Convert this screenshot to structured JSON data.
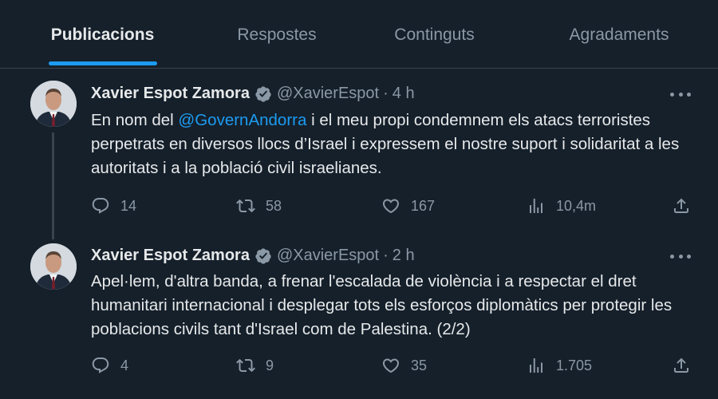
{
  "tabs": [
    {
      "label": "Publicacions",
      "active": true
    },
    {
      "label": "Respostes"
    },
    {
      "label": "Continguts"
    },
    {
      "label": "Agradaments"
    }
  ],
  "tweets": [
    {
      "name": "Xavier Espot Zamora",
      "handle": "@XavierEspot",
      "time": "4 h",
      "text_before": "En nom del ",
      "mention": "@GovernAndorra",
      "text_after": " i el meu propi condemnem els atacs terroristes perpetrats en diversos llocs d’Israel i expressem el nostre suport i solidaritat a les autoritats i a la població civil israelianes.",
      "replies": "14",
      "retweets": "58",
      "likes": "167",
      "views": "10,4m"
    },
    {
      "name": "Xavier Espot Zamora",
      "handle": "@XavierEspot",
      "time": "2 h",
      "text": "Apel·lem, d'altra banda, a frenar l'escalada de violència i a respectar el dret humanitari internacional i desplegar tots els esforços diplomàtics per protegir les poblacions civils tant d'Israel com de Palestina. (2/2)",
      "replies": "4",
      "retweets": "9",
      "likes": "35",
      "views": "1.705"
    }
  ],
  "colors": {
    "background": "#15202b",
    "accent": "#1d9bf0",
    "muted": "#8b98a5",
    "text": "#e7e9ea",
    "divider": "#38444d"
  },
  "icons": [
    "verified-badge-icon",
    "more-icon",
    "reply-icon",
    "retweet-icon",
    "like-icon",
    "views-icon",
    "share-icon"
  ]
}
